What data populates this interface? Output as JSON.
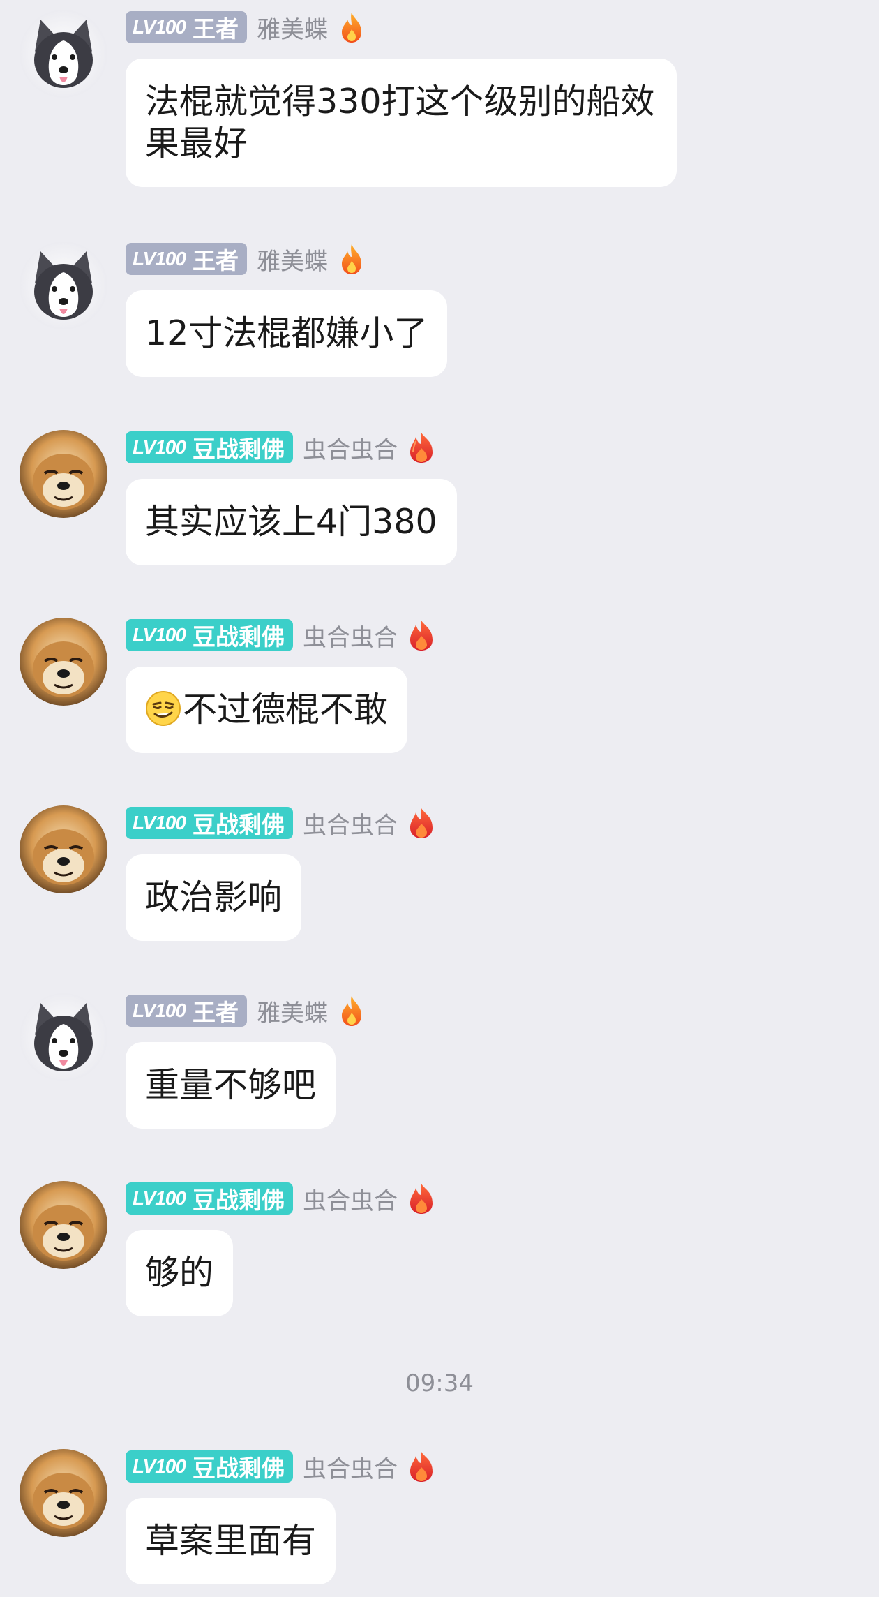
{
  "users": {
    "yameidie": {
      "level": "LV100",
      "title": "王者",
      "nickname": "雅美蝶",
      "avatar": "husky-avatar",
      "badge_color": "#a8aec4"
    },
    "chonghe": {
      "level": "LV100",
      "title": "豆战剩佛",
      "nickname": "虫合虫合",
      "avatar": "shiba-avatar",
      "badge_color": "#3bcfc9"
    }
  },
  "messages": [
    {
      "user": "yameidie",
      "text": "法棍就觉得330打这个级别的船效果最好"
    },
    {
      "user": "yameidie",
      "text": "12寸法棍都嫌小了"
    },
    {
      "user": "chonghe",
      "text": "其实应该上4门380"
    },
    {
      "user": "chonghe",
      "text": "不过德棍不敢",
      "emoji": "smirk-emoji"
    },
    {
      "user": "chonghe",
      "text": "政治影响"
    },
    {
      "user": "yameidie",
      "text": "重量不够吧"
    },
    {
      "user": "chonghe",
      "text": "够的"
    },
    {
      "user": "chonghe",
      "text": "草案里面有"
    }
  ],
  "time_divider": "09:34",
  "icons": {
    "fire": "fire-icon",
    "flame_gray_user": "orange-flame-icon",
    "flame_teal_user": "red-flame-icon"
  }
}
